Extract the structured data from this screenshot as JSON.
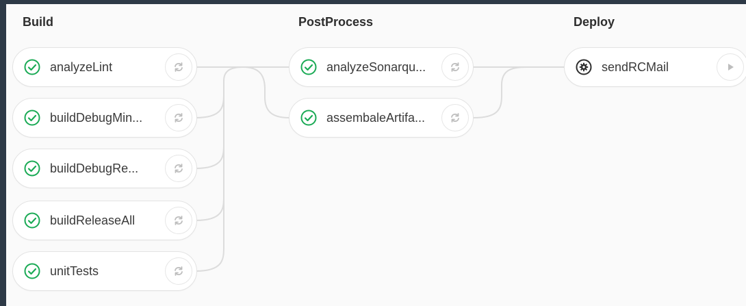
{
  "stages": [
    {
      "title": "Build",
      "jobs": [
        {
          "name": "analyzeLint",
          "status": "success",
          "action": "retry"
        },
        {
          "name": "buildDebugMin...",
          "status": "success",
          "action": "retry"
        },
        {
          "name": "buildDebugRe...",
          "status": "success",
          "action": "retry"
        },
        {
          "name": "buildReleaseAll",
          "status": "success",
          "action": "retry"
        },
        {
          "name": "unitTests",
          "status": "success",
          "action": "retry"
        }
      ]
    },
    {
      "title": "PostProcess",
      "jobs": [
        {
          "name": "analyzeSonarqu...",
          "status": "success",
          "action": "retry"
        },
        {
          "name": "assembaleArtifa...",
          "status": "success",
          "action": "retry"
        }
      ]
    },
    {
      "title": "Deploy",
      "jobs": [
        {
          "name": "sendRCMail",
          "status": "manual",
          "action": "play"
        }
      ]
    }
  ],
  "colors": {
    "success": "#1aaa55",
    "manual": "#2e2e2e",
    "connector": "#dcdcdc",
    "action_icon": "#bdbdbd"
  }
}
